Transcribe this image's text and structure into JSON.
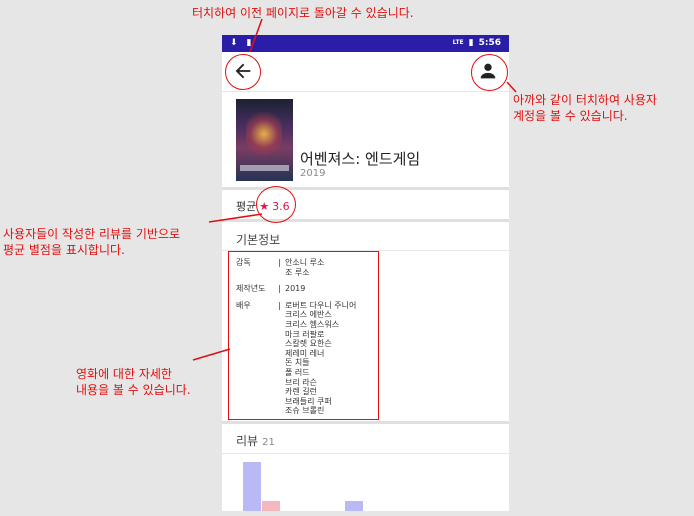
{
  "annotations": {
    "back": "터치하여 이전 페이지로 돌아갈 수 있습니다.",
    "account_line1": "아까와 같이 터치하여 사용자",
    "account_line2": "계정을 볼 수 있습니다.",
    "rating_line1": "사용자들이 작성한 리뷰를 기반으로",
    "rating_line2": "평균 별점을 표시합니다.",
    "details_line1": "영화에 대한 자세한",
    "details_line2": "내용을 볼 수 있습니다."
  },
  "status_bar": {
    "time": "5:56",
    "network": "LTE"
  },
  "app_bar": {
    "back_icon": "arrow-back-icon",
    "account_icon": "account-icon"
  },
  "movie": {
    "title": "어벤져스: 엔드게임",
    "year": "2019"
  },
  "rating": {
    "label": "평균",
    "star": "★",
    "value": "3.6"
  },
  "info": {
    "section_title": "기본정보",
    "director_label": "감독",
    "directors": [
      "안소니 루소",
      "조 루소"
    ],
    "year_label": "제작년도",
    "year": "2019",
    "cast_label": "배우",
    "cast": [
      "로버트 다우니 주니어",
      "크리스 에반스",
      "크리스 헴스워스",
      "마크 러팔로",
      "스칼렛 요한슨",
      "제레미 레너",
      "돈 치들",
      "폴 러드",
      "브리 라슨",
      "카렌 길런",
      "브래들리 쿠퍼",
      "조슈 브롤린"
    ],
    "separator": "|"
  },
  "reviews": {
    "title": "리뷰",
    "count": "21",
    "chart_colors": {
      "blue": "#b8b9f5",
      "pink": "#f4b7bd"
    }
  },
  "colors": {
    "status_bar": "#2a1ea8",
    "accent_red": "#e01010",
    "rating": "#e0134a"
  }
}
